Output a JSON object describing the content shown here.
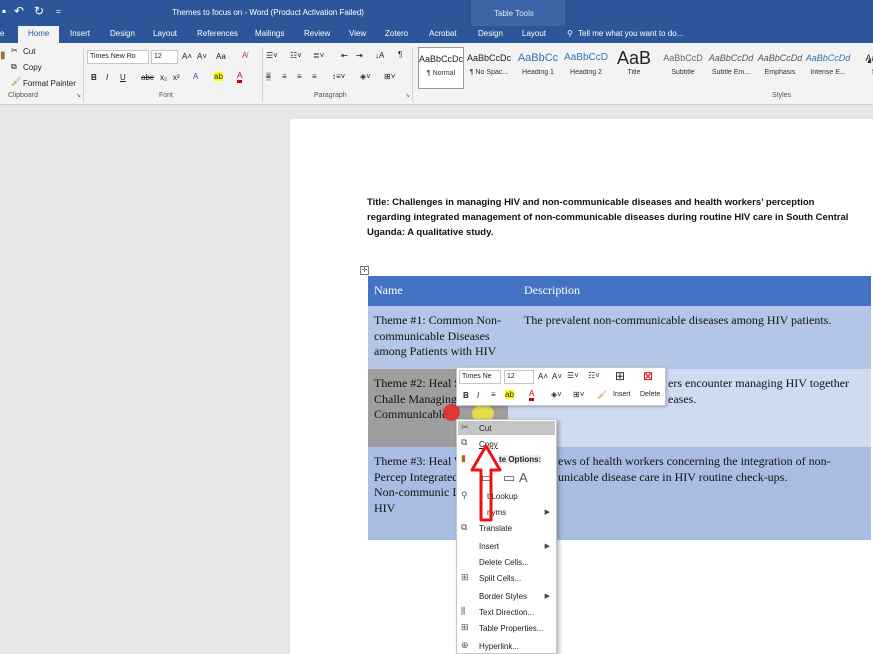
{
  "title_bar": {
    "title": "Themes to focus on - Word (Product Activation Failed)",
    "context_label": "Table Tools"
  },
  "tabs": [
    "e",
    "Home",
    "Insert",
    "Design",
    "Layout",
    "References",
    "Mailings",
    "Review",
    "View",
    "Zotero",
    "Acrobat",
    "Design",
    "Layout"
  ],
  "tell_me": "Tell me what you want to do...",
  "clipboard": {
    "cut": "Cut",
    "copy": "Copy",
    "format_painter": "Format Painter",
    "group": "Clipboard"
  },
  "font": {
    "name": "Times New Ro",
    "size": "12",
    "group": "Font",
    "aa": "Aa"
  },
  "paragraph": {
    "group": "Paragraph"
  },
  "styles": {
    "group": "Styles",
    "items": [
      {
        "preview": "AaBbCcDc",
        "name": "¶ Normal"
      },
      {
        "preview": "AaBbCcDc",
        "name": "¶ No Spac..."
      },
      {
        "preview": "AaBbCc",
        "name": "Heading 1"
      },
      {
        "preview": "AaBbCcD",
        "name": "Heading 2"
      },
      {
        "preview": "AaB",
        "name": "Title"
      },
      {
        "preview": "AaBbCcD",
        "name": "Subtitle"
      },
      {
        "preview": "AaBbCcDd",
        "name": "Subtle Em..."
      },
      {
        "preview": "AaBbCcDd",
        "name": "Emphasis"
      },
      {
        "preview": "AaBbCcDd",
        "name": "Intense E..."
      },
      {
        "preview": "AaBl",
        "name": "St"
      }
    ]
  },
  "document": {
    "title": "Title: Challenges in managing HIV and non-communicable diseases and health workers’ perception regarding integrated management of non-communicable diseases during routine HIV care in South Central Uganda: A qualitative study.",
    "table": {
      "headers": [
        "Name",
        "Description"
      ],
      "rows": [
        {
          "name": "Theme #1: Common Non-communicable Diseases among Patients with HIV",
          "desc": "The prevalent non-communicable diseases among HIV patients."
        },
        {
          "name": "Theme #2: Heal Systems Challe Managing HIV Communicable",
          "desc": "ers encounter managing HIV together eases."
        },
        {
          "name": "Theme #3: Heal Workers’ Percep Integrated Mana Non-communic Diseases in HIV",
          "desc": "ews of health workers concerning the integration of non-unicable disease care in HIV routine check-ups."
        }
      ]
    }
  },
  "mini_toolbar": {
    "font": "Times Ne",
    "size": "12",
    "insert": "Insert",
    "delete": "Delete"
  },
  "context_menu": {
    "items": [
      "Cut",
      "Copy",
      "te Options:",
      "t Lookup",
      "nyms",
      "Translate",
      "Insert",
      "Delete Cells...",
      "Split Cells...",
      "Border Styles",
      "Text Direction...",
      "Table Properties...",
      "Hyperlink..."
    ]
  },
  "colors": {
    "word_blue": "#2b579a",
    "table_header": "#4472c4"
  }
}
